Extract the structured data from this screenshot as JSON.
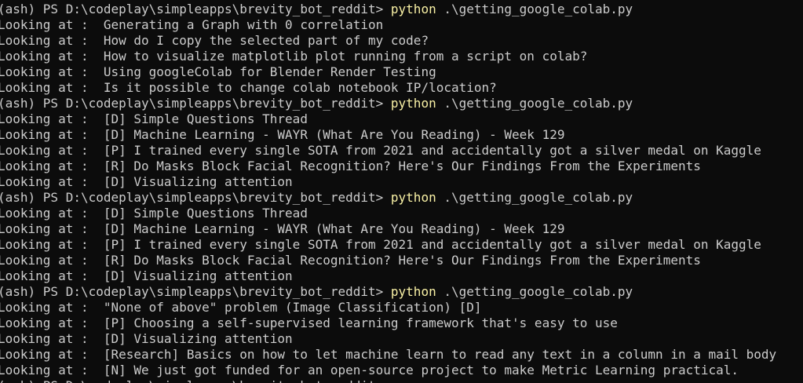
{
  "terminal": {
    "colors": {
      "background": "#0c0c0c",
      "text": "#cccccc",
      "command": "#f9f1a5"
    },
    "lines": [
      {
        "kind": "prompt",
        "prompt": "(ash) PS D:\\codeplay\\simpleapps\\brevity_bot_reddit> ",
        "command": "python",
        "args": " .\\getting_google_colab.py"
      },
      {
        "kind": "output",
        "text": "Looking at :  Generating a Graph with 0 correlation"
      },
      {
        "kind": "output",
        "text": "Looking at :  How do I copy the selected part of my code?"
      },
      {
        "kind": "output",
        "text": "Looking at :  How to visualize matplotlib plot running from a script on colab?"
      },
      {
        "kind": "output",
        "text": "Looking at :  Using googleColab for Blender Render Testing"
      },
      {
        "kind": "output",
        "text": "Looking at :  Is it possible to change colab notebook IP/location?"
      },
      {
        "kind": "prompt",
        "prompt": "(ash) PS D:\\codeplay\\simpleapps\\brevity_bot_reddit> ",
        "command": "python",
        "args": " .\\getting_google_colab.py"
      },
      {
        "kind": "output",
        "text": "Looking at :  [D] Simple Questions Thread"
      },
      {
        "kind": "output",
        "text": "Looking at :  [D] Machine Learning - WAYR (What Are You Reading) - Week 129"
      },
      {
        "kind": "output",
        "text": "Looking at :  [P] I trained every single SOTA from 2021 and accidentally got a silver medal on Kaggle"
      },
      {
        "kind": "output",
        "text": "Looking at :  [R] Do Masks Block Facial Recognition? Here's Our Findings From the Experiments"
      },
      {
        "kind": "output",
        "text": "Looking at :  [D] Visualizing attention"
      },
      {
        "kind": "prompt",
        "prompt": "(ash) PS D:\\codeplay\\simpleapps\\brevity_bot_reddit> ",
        "command": "python",
        "args": " .\\getting_google_colab.py"
      },
      {
        "kind": "output",
        "text": "Looking at :  [D] Simple Questions Thread"
      },
      {
        "kind": "output",
        "text": "Looking at :  [D] Machine Learning - WAYR (What Are You Reading) - Week 129"
      },
      {
        "kind": "output",
        "text": "Looking at :  [P] I trained every single SOTA from 2021 and accidentally got a silver medal on Kaggle"
      },
      {
        "kind": "output",
        "text": "Looking at :  [R] Do Masks Block Facial Recognition? Here's Our Findings From the Experiments"
      },
      {
        "kind": "output",
        "text": "Looking at :  [D] Visualizing attention"
      },
      {
        "kind": "prompt",
        "prompt": "(ash) PS D:\\codeplay\\simpleapps\\brevity_bot_reddit> ",
        "command": "python",
        "args": " .\\getting_google_colab.py"
      },
      {
        "kind": "output",
        "text": "Looking at :  \"None of above\" problem (Image Classification) [D]"
      },
      {
        "kind": "output",
        "text": "Looking at :  [P] Choosing a self-supervised learning framework that's easy to use"
      },
      {
        "kind": "output",
        "text": "Looking at :  [D] Visualizing attention"
      },
      {
        "kind": "output",
        "text": "Looking at :  [Research] Basics on how to let machine learn to read any text in a column in a mail body"
      },
      {
        "kind": "output",
        "text": "Looking at :  [N] We just got funded for an open-source project to make Metric Learning practical."
      },
      {
        "kind": "prompt",
        "prompt": "(ash) PS D:\\codeplay\\simpleapps\\brevity_bot_reddit> ",
        "command": "",
        "args": ""
      }
    ]
  }
}
